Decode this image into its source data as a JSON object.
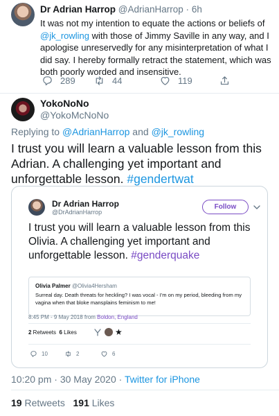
{
  "parent_tweet": {
    "name": "Dr Adrian Harrop",
    "handle": "@AdrianHarrop",
    "separator": "·",
    "time": "6h",
    "text_before": "It was not my intention to equate the actions or beliefs of ",
    "mention": "@jk_rowling",
    "text_after": " with those of Jimmy Saville in any way, and I apologise unreservedly for any misinterpretation of what I did say. I hereby formally retract the statement, which was both poorly worded and insensitive.",
    "replies": "289",
    "retweets": "44",
    "likes": "119",
    "icons": [
      "reply-icon",
      "retweet-icon",
      "heart-icon",
      "share-icon"
    ]
  },
  "tweet": {
    "name": "YokoNoNo",
    "handle": "@YokoMcNoNo",
    "replying_label": "Replying to ",
    "reply_user1": "@AdrianHarrop",
    "reply_and": " and ",
    "reply_user2": "@jk_rowling",
    "text": "I trust you will learn a valuable lesson from this Adrian. A challenging yet important and unforgettable lesson.",
    "hashtag": "#gendertwat"
  },
  "quoted": {
    "name": "Dr Adrian Harrop",
    "handle": "@DrAdrianHarrop",
    "follow_label": "Follow",
    "text": "I trust you will learn a valuable lesson from this Olivia. A challenging yet important and unforgettable lesson.",
    "hashtag": "#genderquake",
    "accent_color": "#794bc4",
    "inner": {
      "name": "Olivia Palmer",
      "handle": "@Olivia4Hersham",
      "text": "Surreal day. Death threats for heckling? I was vocal - I'm on my period, bleeding from my vagina when that bloke mansplains feminism to me!"
    },
    "meta_time": "8:45 PM - 9 May 2018 from ",
    "meta_place": "Boldon, England",
    "retweets_count": "2",
    "retweets_label": " Retweets",
    "likes_count": "6",
    "likes_label": " Likes",
    "action_replies": "10",
    "action_retweets": "2",
    "action_likes": "6"
  },
  "footer": {
    "time": "10:20 pm · 30 May 2020 · ",
    "source": "Twitter for iPhone",
    "retweets_count": "19",
    "retweets_label": " Retweets",
    "likes_count": "191",
    "likes_label": " Likes"
  },
  "colors": {
    "link": "#1b95e0",
    "muted": "#657786",
    "text": "#14171a"
  }
}
